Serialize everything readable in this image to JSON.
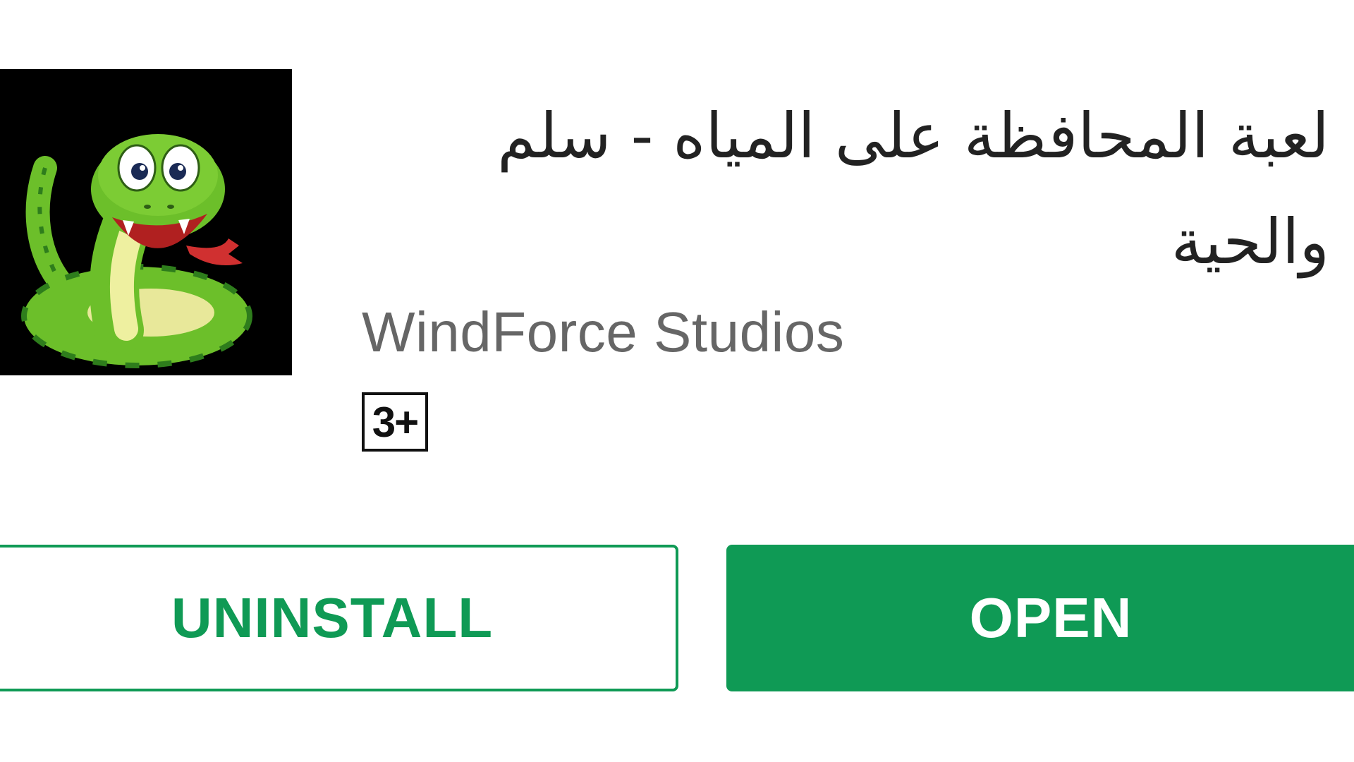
{
  "app": {
    "title_line1": "لعبة المحافظة على المياه - سلم",
    "title_line2": "والحية",
    "developer": "WindForce Studios",
    "content_rating": "3+",
    "icon": "snake-icon"
  },
  "actions": {
    "uninstall_label": "UNINSTALL",
    "open_label": "OPEN"
  },
  "colors": {
    "accent": "#0f9a55",
    "title_text": "#222222",
    "developer_text": "#666666",
    "background": "#ffffff"
  }
}
